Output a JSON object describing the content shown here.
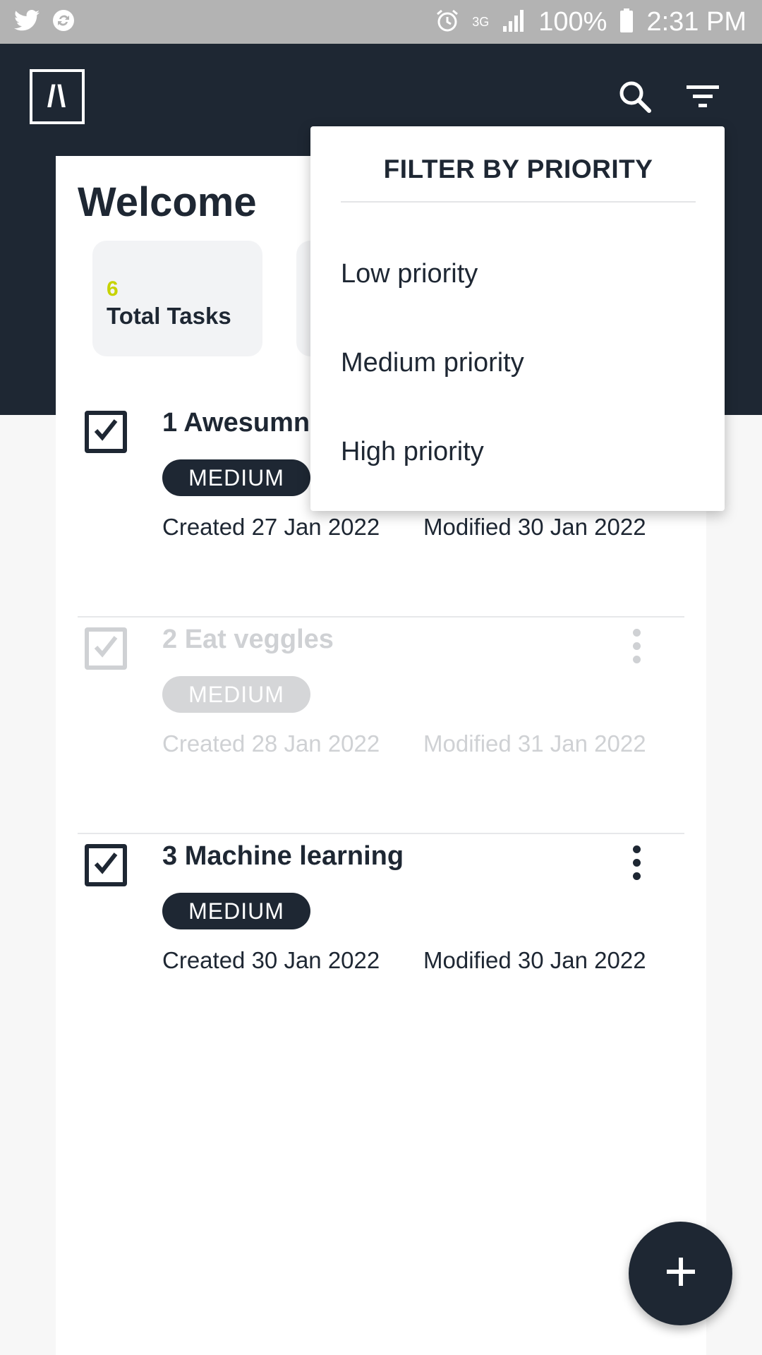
{
  "status_bar": {
    "network": "3G",
    "battery": "100%",
    "time": "2:31 PM",
    "icons": [
      "twitter-icon",
      "sync-icon",
      "alarm-icon",
      "signal-icon",
      "battery-icon"
    ]
  },
  "header": {
    "logo_text": "/\\",
    "search_icon": "search-icon",
    "filter_icon": "filter-icon"
  },
  "welcome": {
    "title": "Welcome"
  },
  "stats": [
    {
      "value": "6",
      "label": "Total Tasks"
    }
  ],
  "tasks": [
    {
      "title": "1 Awesumn",
      "priority": "MEDIUM",
      "created": "Created 27 Jan 2022",
      "modified": "Modified 30 Jan 2022",
      "completed": true,
      "dimmed": false
    },
    {
      "title": "2 Eat veggles",
      "priority": "MEDIUM",
      "created": "Created 28 Jan 2022",
      "modified": "Modified 31 Jan 2022",
      "completed": true,
      "dimmed": true
    },
    {
      "title": "3 Machine learning",
      "priority": "MEDIUM",
      "created": "Created 30 Jan 2022",
      "modified": "Modified 30 Jan 2022",
      "completed": true,
      "dimmed": false
    }
  ],
  "filter_menu": {
    "title": "FILTER BY PRIORITY",
    "options": [
      "Low priority",
      "Medium priority",
      "High priority"
    ]
  },
  "fab": {
    "icon": "plus-icon"
  },
  "colors": {
    "primary": "#1e2733",
    "accent": "#c7d300",
    "status_bar": "#b3b3b3",
    "background": "#f7f7f7"
  }
}
